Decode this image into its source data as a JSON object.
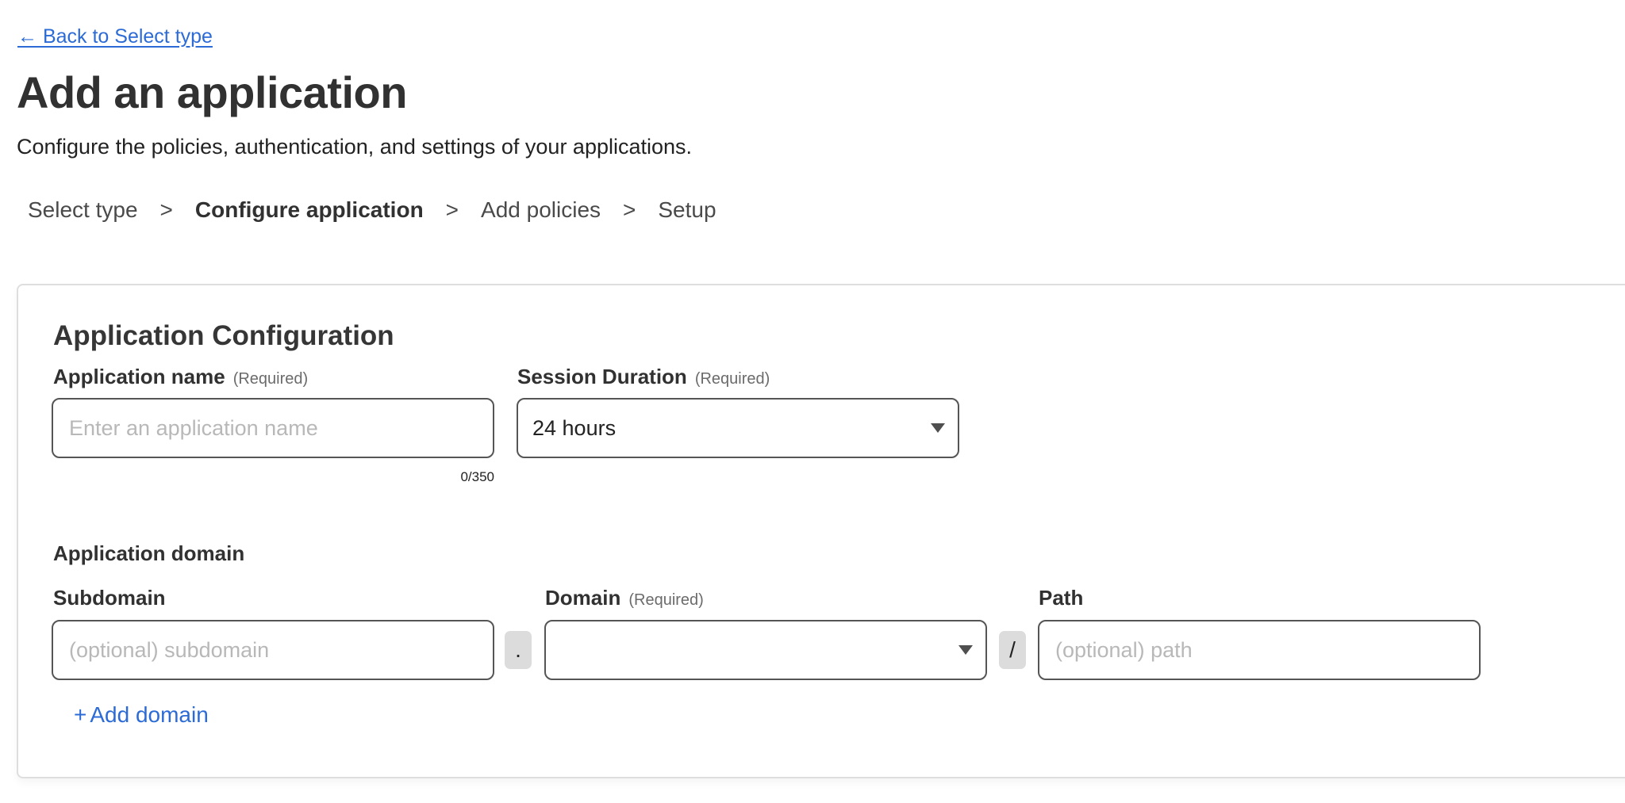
{
  "back_link": {
    "label": "← Back to Select type"
  },
  "page": {
    "title": "Add an application",
    "subtitle": "Configure the policies, authentication, and settings of your applications."
  },
  "stepper": {
    "separator": ">",
    "steps": [
      {
        "label": "Select type",
        "active": false
      },
      {
        "label": "Configure application",
        "active": true
      },
      {
        "label": "Add policies",
        "active": false
      },
      {
        "label": "Setup",
        "active": false
      }
    ]
  },
  "card": {
    "title": "Application Configuration",
    "app_name": {
      "label": "Application name",
      "required": "(Required)",
      "value": "",
      "placeholder": "Enter an application name",
      "counter": "0/350"
    },
    "session_duration": {
      "label": "Session Duration",
      "required": "(Required)",
      "selected": "24 hours"
    },
    "domain_section": {
      "title": "Application domain",
      "subdomain": {
        "label": "Subdomain",
        "value": "",
        "placeholder": "(optional) subdomain"
      },
      "dot_separator": ".",
      "domain": {
        "label": "Domain",
        "required": "(Required)",
        "selected": ""
      },
      "slash_separator": "/",
      "path": {
        "label": "Path",
        "value": "",
        "placeholder": "(optional) path"
      },
      "add_domain": {
        "icon": "plus-icon",
        "label": "Add domain",
        "plus": "+"
      }
    }
  },
  "colors": {
    "link": "#2c6bd6",
    "text": "#313131",
    "placeholder": "#b8b8b8",
    "border": "#555555",
    "chip": "#dcdcdc"
  }
}
